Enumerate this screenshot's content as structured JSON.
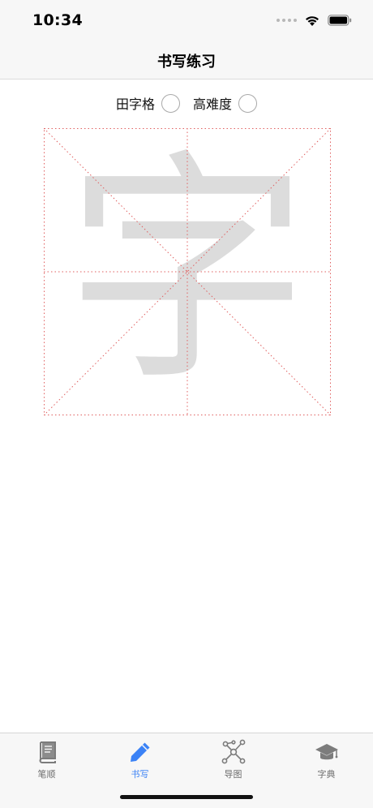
{
  "status_bar": {
    "time": "10:34",
    "icons": [
      "signal-dots-icon",
      "wifi-icon",
      "battery-icon"
    ]
  },
  "nav": {
    "title": "书写练习"
  },
  "options": [
    {
      "label": "田字格",
      "checked": false
    },
    {
      "label": "高难度",
      "checked": false
    }
  ],
  "practice": {
    "character": "字"
  },
  "colors": {
    "accent": "#3b82f6",
    "grid_line": "#e06060",
    "glyph": "#dcdcdc"
  },
  "tabs": [
    {
      "label": "笔顺",
      "icon": "book-icon",
      "active": false
    },
    {
      "label": "书写",
      "icon": "pencil-icon",
      "active": true
    },
    {
      "label": "导图",
      "icon": "mindmap-icon",
      "active": false
    },
    {
      "label": "字典",
      "icon": "graduation-cap-icon",
      "active": false
    }
  ]
}
